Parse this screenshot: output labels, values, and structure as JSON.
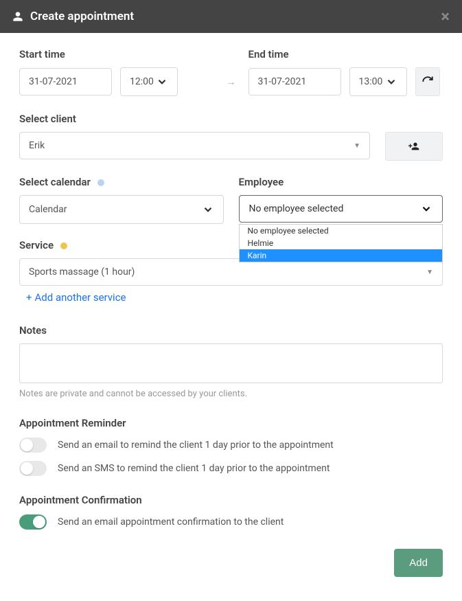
{
  "header": {
    "title": "Create appointment"
  },
  "time": {
    "start_label": "Start time",
    "end_label": "End time",
    "start_date": "31-07-2021",
    "start_time": "12:00",
    "end_date": "31-07-2021",
    "end_time": "13:00"
  },
  "client": {
    "label": "Select client",
    "value": "Erik"
  },
  "calendar": {
    "label": "Select calendar",
    "value": "Calendar"
  },
  "employee": {
    "label": "Employee",
    "value": "No employee selected",
    "options": [
      "No employee selected",
      "Helmie",
      "Karin"
    ],
    "highlighted": "Karin"
  },
  "service": {
    "label": "Service",
    "value": "Sports massage (1 hour)",
    "add_another": "Add another service"
  },
  "notes": {
    "label": "Notes",
    "hint": "Notes are private and cannot be accessed by your clients."
  },
  "reminder": {
    "label": "Appointment Reminder",
    "email_text": "Send an email to remind the client 1 day prior to the appointment",
    "sms_text": "Send an SMS to remind the client 1 day prior to the appointment"
  },
  "confirmation": {
    "label": "Appointment Confirmation",
    "email_text": "Send an email appointment confirmation to the client"
  },
  "footer": {
    "add_label": "Add"
  }
}
